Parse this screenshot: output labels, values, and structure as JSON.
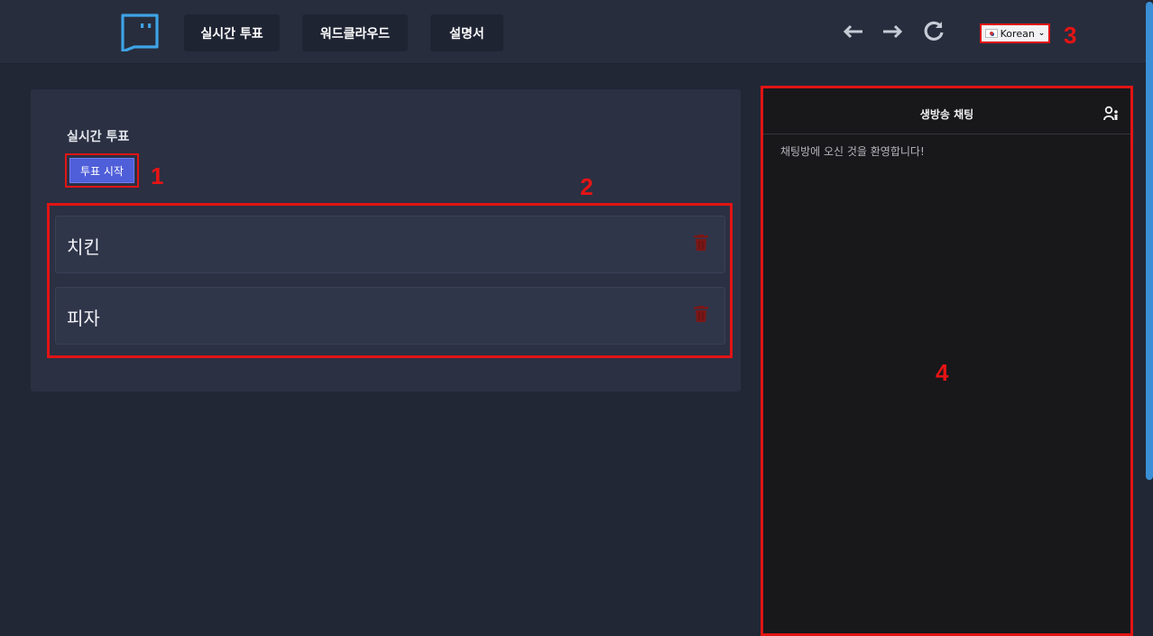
{
  "nav": {
    "items": [
      "실시간 투표",
      "워드클라우드",
      "설명서"
    ],
    "back_icon": "arrow-left-icon",
    "forward_icon": "arrow-right-icon",
    "reload_icon": "reload-icon"
  },
  "language": {
    "selected": "Korean",
    "flag_icon": "korea-flag-icon"
  },
  "annotations": [
    "1",
    "2",
    "3",
    "4"
  ],
  "vote": {
    "title": "실시간 투표",
    "start_label": "투표 시작",
    "items": [
      {
        "label": "치킨",
        "delete_icon": "trash-icon"
      },
      {
        "label": "피자",
        "delete_icon": "trash-icon"
      }
    ]
  },
  "chat": {
    "title": "생방송 채팅",
    "users_icon": "users-icon",
    "welcome": "채팅방에 오신 것을 환영합니다!"
  },
  "colors": {
    "background": "#222735",
    "panel": "#2b3043",
    "accent_button": "#4f5ed9",
    "annotation_red": "#e51414",
    "logo_blue": "#3ea3e6",
    "chat_bg": "#18181b",
    "delete_red": "#7a1717"
  }
}
